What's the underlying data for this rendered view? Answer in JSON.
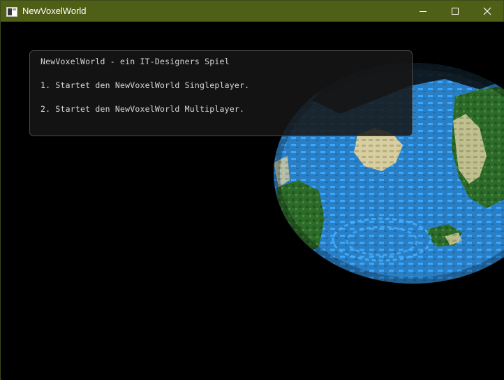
{
  "window": {
    "title": "NewVoxelWorld",
    "app_icon": "window-app-icon",
    "controls": [
      "minimize-icon",
      "maximize-icon",
      "close-icon"
    ],
    "titlebar_color": "#4f5f16"
  },
  "menu": {
    "heading": "NewVoxelWorld - ein IT-Designers Spiel",
    "options": [
      "1. Startet den NewVoxelWorld Singleplayer.",
      "2. Startet den NewVoxelWorld Multiplayer."
    ]
  },
  "scene": {
    "background": "#000000",
    "globe_colors": {
      "ocean": "#2a7fc4",
      "land": "#2e6b2a",
      "sand": "#d8cfa0"
    }
  }
}
